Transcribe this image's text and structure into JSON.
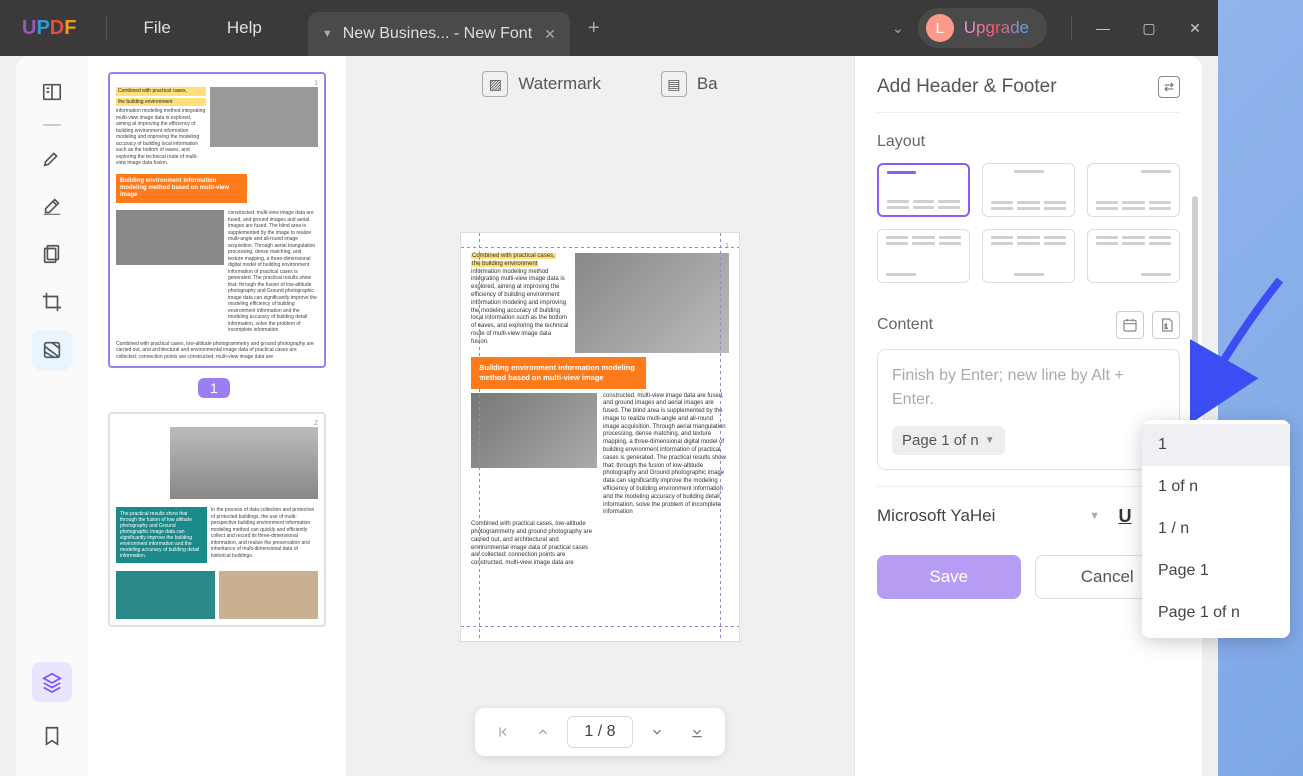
{
  "titlebar": {
    "menus": {
      "file": "File",
      "help": "Help"
    },
    "tab_title": "New Busines... - New Font",
    "avatar_letter": "L",
    "upgrade": "Upgrade"
  },
  "top_tools": {
    "watermark": "Watermark",
    "background": "Ba"
  },
  "thumbs": {
    "page1_label": "1",
    "page2_label": "2",
    "hl_line1": "Combined with practical cases,",
    "hl_line2": "the building environment",
    "orange_title": "Building environment information modeling method based on multi-view image",
    "body": "information modeling method integrating multi-view image data is explored, aiming at improving the efficiency of building environment information modeling and improving the modeling accuracy of building local information such as the bottom of eaves, and exploring the technical route of multi-view image data fusion.",
    "body2": "constructed, multi-view image data are fused, and ground images and aerial images are fused. The blind area is supplemented by the image to realize multi-angle and all-round image acquisition. Through aerial triangulation processing, dense matching, and texture mapping, a three-dimensional digital model of building environment information of practical cases is generated. The practical results show that: through the fusion of low-altitude photography and Ground photographic image data can significantly improve the modeling efficiency of building environment information and the modeling accuracy of building detail information, solve the problem of incomplete information",
    "body3": "Combined with practical cases, low-altitude photogrammetry and ground photography are carried out, and architectural and environmental image data of practical cases are collected; connection points are constructed, multi-view image data are"
  },
  "sidepanel": {
    "title": "Add Header & Footer",
    "layout_label": "Layout",
    "content_label": "Content",
    "placeholder": "Finish by Enter; new line by Alt + Enter.",
    "chip": "Page 1 of n",
    "font": "Microsoft YaHei",
    "save": "Save",
    "cancel": "Cancel"
  },
  "pager": {
    "current": "1",
    "total": "8",
    "combined": "1  /  8"
  },
  "dropdown": {
    "options": [
      "1",
      "1 of n",
      "1 / n",
      "Page 1",
      "Page 1 of n"
    ]
  }
}
